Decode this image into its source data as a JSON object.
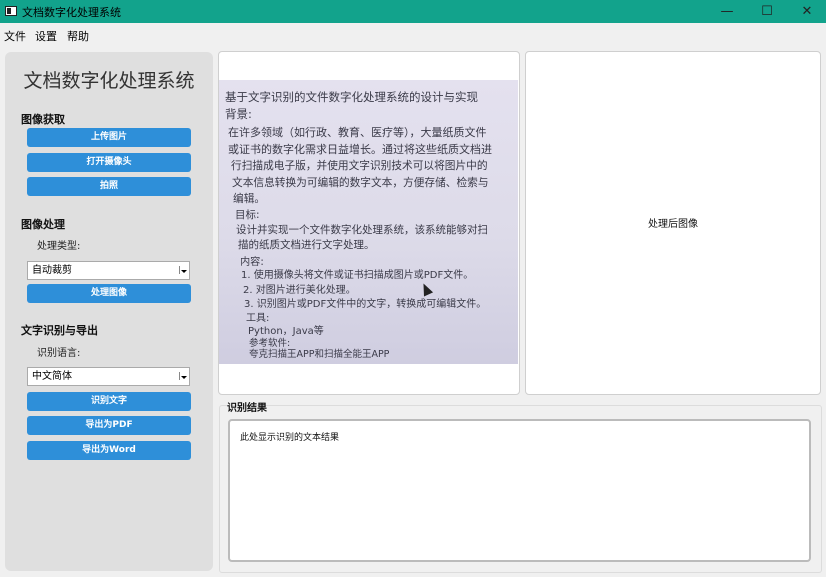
{
  "window": {
    "title": "文档数字化处理系统",
    "minimize": "—",
    "maximize": "☐",
    "close": "✕"
  },
  "menu": {
    "file": "文件",
    "settings": "设置",
    "help": "帮助"
  },
  "sidebar": {
    "title": "文档数字化处理系统",
    "acquire": {
      "heading": "图像获取",
      "upload": "上传图片",
      "camera": "打开摄像头",
      "capture": "拍照"
    },
    "process": {
      "heading": "图像处理",
      "type_label": "处理类型:",
      "type_value": "自动裁剪",
      "process_btn": "处理图像"
    },
    "ocr": {
      "heading": "文字识别与导出",
      "lang_label": "识别语言:",
      "lang_value": "中文简体",
      "recognize_btn": "识别文字",
      "export_pdf": "导出为PDF",
      "export_word": "导出为Word"
    }
  },
  "original_doc": {
    "lines": [
      "基于文字识别的文件数字化处理系统的设计与实现",
      "背景:",
      "在许多领域（如行政、教育、医疗等），大量纸质文件",
      "或证书的数字化需求日益增长。通过将这些纸质文档进",
      "行扫描成电子版，并使用文字识别技术可以将图片中的",
      "文本信息转换为可编辑的数字文本，方便存储、检索与",
      "编辑。",
      "目标:",
      "设计并实现一个文件数字化处理系统，该系统能够对扫",
      "描的纸质文档进行文字处理。",
      "内容:",
      "1. 使用摄像头将文件或证书扫描成图片或PDF文件。",
      "2. 对图片进行美化处理。",
      "3. 识别图片或PDF文件中的文字，转换成可编辑文件。",
      "工具:",
      "Python，Java等",
      "参考软件:",
      "夸克扫描王APP和扫描全能王APP"
    ]
  },
  "processed": {
    "placeholder": "处理后图像"
  },
  "result": {
    "heading": "识别结果",
    "text": "此处显示识别的文本结果"
  }
}
